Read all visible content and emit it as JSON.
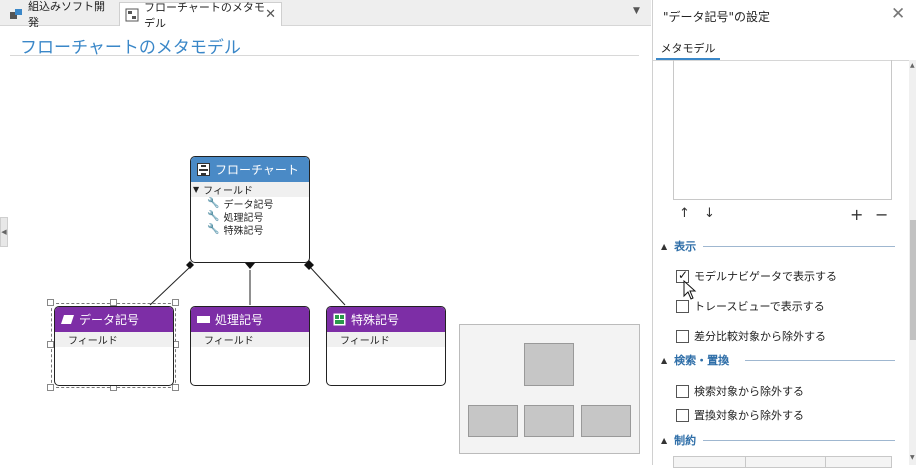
{
  "tabs": [
    {
      "label": "組込みソフト開発",
      "icon": "project-icon"
    },
    {
      "label": "フローチャートのメタモデル",
      "icon": "diagram-icon",
      "close": "✕"
    }
  ],
  "canvas": {
    "title": "フローチャートのメタモデル"
  },
  "nodes": {
    "flowchart": {
      "title": "フローチャート",
      "field_header": "フィールド",
      "fields": [
        "データ記号",
        "処理記号",
        "特殊記号"
      ]
    },
    "data": {
      "title": "データ記号",
      "field": "フィールド"
    },
    "process": {
      "title": "処理記号",
      "field": "フィールド"
    },
    "special": {
      "title": "特殊記号",
      "field": "フィールド"
    }
  },
  "panel": {
    "title": "\"データ記号\"の設定",
    "close": "✕",
    "tab": "メタモデル",
    "up": "↑",
    "down": "↓",
    "plus": "+",
    "minus": "−",
    "sections": {
      "display": {
        "label": "表示",
        "items": [
          {
            "label": "モデルナビゲータで表示する",
            "checked": true
          },
          {
            "label": "トレースビューで表示する",
            "checked": false
          },
          {
            "label": "差分比較対象から除外する",
            "checked": false
          }
        ]
      },
      "search": {
        "label": "検索・置換",
        "items": [
          {
            "label": "検索対象から除外する",
            "checked": false
          },
          {
            "label": "置換対象から除外する",
            "checked": false
          }
        ]
      },
      "constraint": {
        "label": "制約"
      }
    }
  },
  "colors": {
    "accent": "#3a87c8",
    "node_blue": "#4a8ac6",
    "node_purple": "#7d2ea6"
  }
}
